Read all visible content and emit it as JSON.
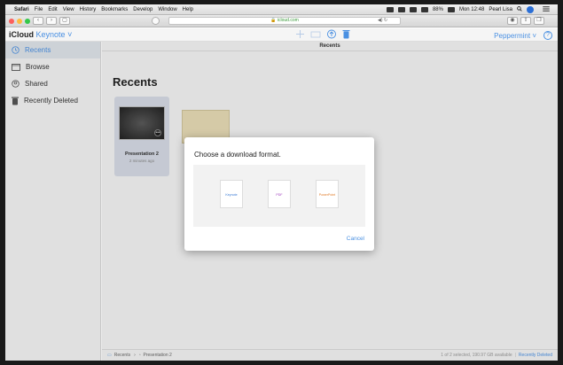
{
  "menubar": {
    "apple": "",
    "app_name": "Safari",
    "menus": [
      "File",
      "Edit",
      "View",
      "History",
      "Bookmarks",
      "Develop",
      "Window",
      "Help"
    ],
    "battery": "88%",
    "clock": "Mon 12:48",
    "user": "Pearl Lisa"
  },
  "browser": {
    "url": "icloud.com",
    "url_status": "◀) ↻"
  },
  "header": {
    "brand": "iCloud",
    "app_name": "Keynote",
    "user_name": "Peppermint",
    "help": "?"
  },
  "sidebar": {
    "items": [
      {
        "label": "Recents",
        "icon": "clock-icon",
        "active": true
      },
      {
        "label": "Browse",
        "icon": "folder-icon",
        "active": false
      },
      {
        "label": "Shared",
        "icon": "people-icon",
        "active": false
      },
      {
        "label": "Recently Deleted",
        "icon": "trash-icon",
        "active": false
      }
    ]
  },
  "main": {
    "header_title": "Recents",
    "heading": "Recents",
    "file": {
      "name": "Presentation 2",
      "modified": "2 minutes ago"
    }
  },
  "status": {
    "path_root": "Recents",
    "path_separator": "›",
    "path_file": "Presentation 2",
    "summary": "1 of 2 selected, 190.97 GB available",
    "separator": "|",
    "deleted_link": "Recently Deleted"
  },
  "dialog": {
    "title": "Choose a download format.",
    "formats": [
      "Keynote",
      "PDF",
      "PowerPoint"
    ],
    "cancel": "Cancel"
  },
  "colors": {
    "accent": "#4a90e2",
    "selected_bg": "#dfe4ea"
  }
}
